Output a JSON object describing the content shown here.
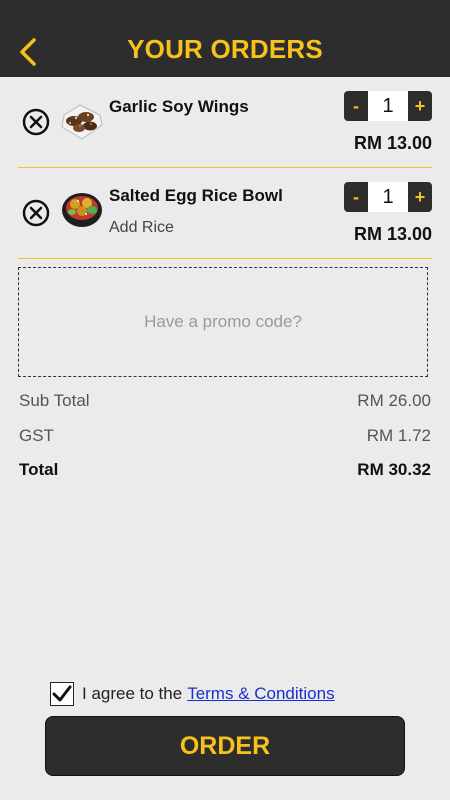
{
  "header": {
    "title": "YOUR ORDERS",
    "back_icon": "chevron-left-icon"
  },
  "items": [
    {
      "name": "Garlic Soy Wings",
      "option": "",
      "quantity": "1",
      "price": "RM 13.00",
      "decrement": "-",
      "increment": "+"
    },
    {
      "name": "Salted Egg Rice Bowl",
      "option": "Add Rice",
      "quantity": "1",
      "price": "RM 13.00",
      "decrement": "-",
      "increment": "+"
    }
  ],
  "promo": {
    "placeholder": "Have a promo code?"
  },
  "summary": {
    "subtotal_label": "Sub Total",
    "subtotal_value": "RM 26.00",
    "gst_label": "GST",
    "gst_value": "RM 1.72",
    "total_label": "Total",
    "total_value": "RM 30.32"
  },
  "agreement": {
    "text": "I agree to the",
    "link": "Terms & Conditions",
    "checked": true
  },
  "order_button": {
    "label": "ORDER"
  },
  "colors": {
    "accent": "#f7c21b",
    "header_bg": "#2d2d2d",
    "background": "#ebebeb",
    "link": "#1a2fd0"
  }
}
